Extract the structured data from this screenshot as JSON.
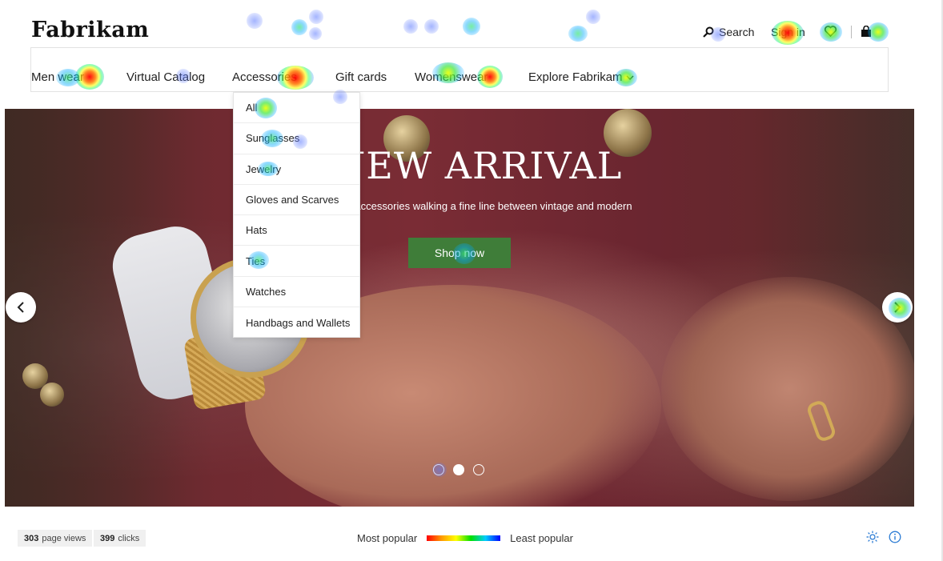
{
  "header": {
    "logo": "Fabrikam",
    "search_label": "Search",
    "signin_label": "Sign in",
    "wishlist_icon": "heart-icon",
    "bag_icon": "bag-icon"
  },
  "nav": {
    "items": [
      {
        "label": "Men wear"
      },
      {
        "label": "Virtual Catalog"
      },
      {
        "label": "Accessories"
      },
      {
        "label": "Gift cards"
      },
      {
        "label": "Womenswear"
      },
      {
        "label": "Explore Fabrikam"
      }
    ]
  },
  "dropdown": {
    "items": [
      {
        "label": "All"
      },
      {
        "label": "Sunglasses"
      },
      {
        "label": "Jewelry"
      },
      {
        "label": "Gloves and Scarves"
      },
      {
        "label": "Hats"
      },
      {
        "label": "Ties"
      },
      {
        "label": "Watches"
      },
      {
        "label": "Handbags and Wallets"
      }
    ]
  },
  "hero": {
    "title": "NEW ARRIVAL",
    "subtitle": "Accessories walking a fine line between vintage and modern",
    "cta": "Shop now",
    "slide_count": 3,
    "active_slide": 2
  },
  "stats": {
    "page_views_value": "303",
    "page_views_label": "page views",
    "clicks_value": "399",
    "clicks_label": "clicks"
  },
  "legend": {
    "most": "Most popular",
    "least": "Least popular",
    "gradient_colors": [
      "#ff0000",
      "#ff9900",
      "#ffff00",
      "#00e000",
      "#00ccff",
      "#0000ff"
    ]
  },
  "colors": {
    "cta_green": "#3f7d39",
    "hero_maroon": "#7a2c35"
  }
}
